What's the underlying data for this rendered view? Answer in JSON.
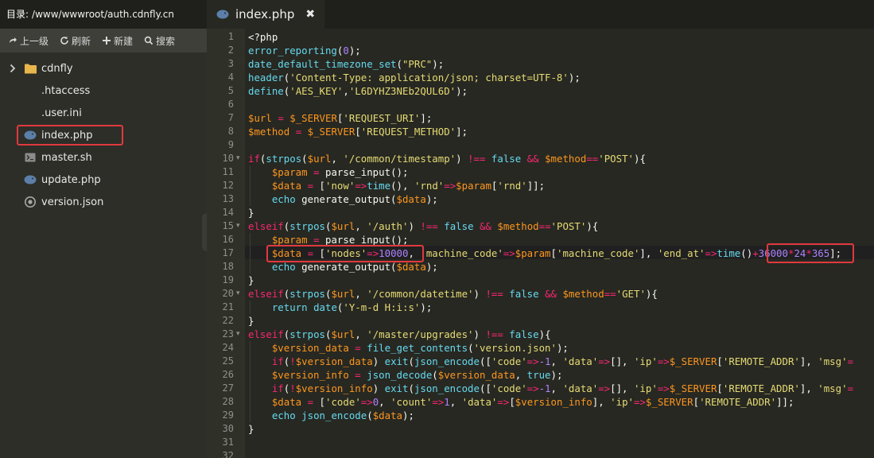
{
  "sidebar": {
    "path_label": "目录:",
    "path": "/www/wwwroot/auth.cdnfly.cn",
    "toolbar": [
      {
        "icon": "up-arrow-icon",
        "label": "上一级"
      },
      {
        "icon": "refresh-icon",
        "label": "刷新"
      },
      {
        "icon": "plus-icon",
        "label": "新建"
      },
      {
        "icon": "search-icon",
        "label": "搜索"
      }
    ],
    "items": [
      {
        "name": "cdnfly",
        "type": "folder"
      },
      {
        "name": ".htaccess",
        "type": "file"
      },
      {
        "name": ".user.ini",
        "type": "file"
      },
      {
        "name": "index.php",
        "type": "php",
        "selected": true
      },
      {
        "name": "master.sh",
        "type": "shell"
      },
      {
        "name": "update.php",
        "type": "php"
      },
      {
        "name": "version.json",
        "type": "json"
      }
    ]
  },
  "tab": {
    "name": "index.php",
    "close": "✖"
  },
  "colors": {
    "accent_red": "#e0393e",
    "editor_bg": "#272822"
  },
  "line_numbers": [
    "1",
    "2",
    "3",
    "4",
    "5",
    "6",
    "7",
    "8",
    "9",
    "10",
    "11",
    "12",
    "13",
    "14",
    "15",
    "16",
    "17",
    "18",
    "19",
    "20",
    "21",
    "22",
    "23",
    "24",
    "25",
    "26",
    "27",
    "28",
    "29",
    "30",
    "31",
    "32"
  ],
  "code_lines": [
    [
      [
        "t-pl",
        "<?php"
      ]
    ],
    [
      [
        "t-fn",
        "error_reporting"
      ],
      [
        "t-pl",
        "("
      ],
      [
        "t-num",
        "0"
      ],
      [
        "t-pl",
        ");"
      ]
    ],
    [
      [
        "t-fn",
        "date_default_timezone_set"
      ],
      [
        "t-pl",
        "("
      ],
      [
        "t-str",
        "\"PRC\""
      ],
      [
        "t-pl",
        ");"
      ]
    ],
    [
      [
        "t-fn",
        "header"
      ],
      [
        "t-pl",
        "("
      ],
      [
        "t-str",
        "'Content-Type: application/json; charset=UTF-8'"
      ],
      [
        "t-pl",
        ");"
      ]
    ],
    [
      [
        "t-fn",
        "define"
      ],
      [
        "t-pl",
        "("
      ],
      [
        "t-str",
        "'AES_KEY'"
      ],
      [
        "t-pl",
        ","
      ],
      [
        "t-str",
        "'L6DYHZ3NEb2QUL6D'"
      ],
      [
        "t-pl",
        ");"
      ]
    ],
    [],
    [
      [
        "t-var",
        "$url"
      ],
      [
        "t-pl",
        " "
      ],
      [
        "t-kw",
        "="
      ],
      [
        "t-pl",
        " "
      ],
      [
        "t-var",
        "$_SERVER"
      ],
      [
        "t-pl",
        "["
      ],
      [
        "t-str",
        "'REQUEST_URI'"
      ],
      [
        "t-pl",
        "];"
      ]
    ],
    [
      [
        "t-var",
        "$method"
      ],
      [
        "t-pl",
        " "
      ],
      [
        "t-kw",
        "="
      ],
      [
        "t-pl",
        " "
      ],
      [
        "t-var",
        "$_SERVER"
      ],
      [
        "t-pl",
        "["
      ],
      [
        "t-str",
        "'REQUEST_METHOD'"
      ],
      [
        "t-pl",
        "];"
      ]
    ],
    [],
    [
      [
        "t-kw",
        "if"
      ],
      [
        "t-pl",
        "("
      ],
      [
        "t-fn",
        "strpos"
      ],
      [
        "t-pl",
        "("
      ],
      [
        "t-var",
        "$url"
      ],
      [
        "t-pl",
        ", "
      ],
      [
        "t-str",
        "'/common/timestamp'"
      ],
      [
        "t-pl",
        ") "
      ],
      [
        "t-kw",
        "!=="
      ],
      [
        "t-pl",
        " "
      ],
      [
        "t-fn",
        "false"
      ],
      [
        "t-pl",
        " "
      ],
      [
        "t-kw",
        "&&"
      ],
      [
        "t-pl",
        " "
      ],
      [
        "t-var",
        "$method"
      ],
      [
        "t-kw",
        "=="
      ],
      [
        "t-str",
        "'POST'"
      ],
      [
        "t-pl",
        "){"
      ]
    ],
    [
      [
        "t-pl",
        "    "
      ],
      [
        "t-var",
        "$param"
      ],
      [
        "t-pl",
        " "
      ],
      [
        "t-kw",
        "="
      ],
      [
        "t-pl",
        " parse_input();"
      ]
    ],
    [
      [
        "t-pl",
        "    "
      ],
      [
        "t-var",
        "$data"
      ],
      [
        "t-pl",
        " "
      ],
      [
        "t-kw",
        "="
      ],
      [
        "t-pl",
        " ["
      ],
      [
        "t-str",
        "'now'"
      ],
      [
        "t-kw",
        "=>"
      ],
      [
        "t-fn",
        "time"
      ],
      [
        "t-pl",
        "(), "
      ],
      [
        "t-str",
        "'rnd'"
      ],
      [
        "t-kw",
        "=>"
      ],
      [
        "t-var",
        "$param"
      ],
      [
        "t-pl",
        "["
      ],
      [
        "t-str",
        "'rnd'"
      ],
      [
        "t-pl",
        "]];"
      ]
    ],
    [
      [
        "t-pl",
        "    "
      ],
      [
        "t-fn",
        "echo"
      ],
      [
        "t-pl",
        " generate_output("
      ],
      [
        "t-var",
        "$data"
      ],
      [
        "t-pl",
        ");"
      ]
    ],
    [
      [
        "t-pl",
        "}"
      ]
    ],
    [
      [
        "t-kw",
        "elseif"
      ],
      [
        "t-pl",
        "("
      ],
      [
        "t-fn",
        "strpos"
      ],
      [
        "t-pl",
        "("
      ],
      [
        "t-var",
        "$url"
      ],
      [
        "t-pl",
        ", "
      ],
      [
        "t-str",
        "'/auth'"
      ],
      [
        "t-pl",
        ") "
      ],
      [
        "t-kw",
        "!=="
      ],
      [
        "t-pl",
        " "
      ],
      [
        "t-fn",
        "false"
      ],
      [
        "t-pl",
        " "
      ],
      [
        "t-kw",
        "&&"
      ],
      [
        "t-pl",
        " "
      ],
      [
        "t-var",
        "$method"
      ],
      [
        "t-kw",
        "=="
      ],
      [
        "t-str",
        "'POST'"
      ],
      [
        "t-pl",
        "){"
      ]
    ],
    [
      [
        "t-pl",
        "    "
      ],
      [
        "t-var",
        "$param"
      ],
      [
        "t-pl",
        " "
      ],
      [
        "t-kw",
        "="
      ],
      [
        "t-pl",
        " parse_input();"
      ]
    ],
    [
      [
        "t-pl",
        "    "
      ],
      [
        "t-var",
        "$data"
      ],
      [
        "t-pl",
        " "
      ],
      [
        "t-kw",
        "="
      ],
      [
        "t-pl",
        " ["
      ],
      [
        "t-str",
        "'nodes'"
      ],
      [
        "t-kw",
        "=>"
      ],
      [
        "t-num",
        "10000"
      ],
      [
        "t-pl",
        ", "
      ],
      [
        "t-str",
        "'machine_code'"
      ],
      [
        "t-kw",
        "=>"
      ],
      [
        "t-var",
        "$param"
      ],
      [
        "t-pl",
        "["
      ],
      [
        "t-str",
        "'machine_code'"
      ],
      [
        "t-pl",
        "], "
      ],
      [
        "t-str",
        "'end_at'"
      ],
      [
        "t-kw",
        "=>"
      ],
      [
        "t-fn",
        "time"
      ],
      [
        "t-pl",
        "()"
      ],
      [
        "t-kw",
        "+"
      ],
      [
        "t-num",
        "36000"
      ],
      [
        "t-kw",
        "*"
      ],
      [
        "t-num",
        "24"
      ],
      [
        "t-kw",
        "*"
      ],
      [
        "t-num",
        "365"
      ],
      [
        "t-pl",
        "];"
      ]
    ],
    [
      [
        "t-pl",
        "    "
      ],
      [
        "t-fn",
        "echo"
      ],
      [
        "t-pl",
        " generate_output("
      ],
      [
        "t-var",
        "$data"
      ],
      [
        "t-pl",
        ");"
      ]
    ],
    [
      [
        "t-pl",
        "}"
      ]
    ],
    [
      [
        "t-kw",
        "elseif"
      ],
      [
        "t-pl",
        "("
      ],
      [
        "t-fn",
        "strpos"
      ],
      [
        "t-pl",
        "("
      ],
      [
        "t-var",
        "$url"
      ],
      [
        "t-pl",
        ", "
      ],
      [
        "t-str",
        "'/common/datetime'"
      ],
      [
        "t-pl",
        ") "
      ],
      [
        "t-kw",
        "!=="
      ],
      [
        "t-pl",
        " "
      ],
      [
        "t-fn",
        "false"
      ],
      [
        "t-pl",
        " "
      ],
      [
        "t-kw",
        "&&"
      ],
      [
        "t-pl",
        " "
      ],
      [
        "t-var",
        "$method"
      ],
      [
        "t-kw",
        "=="
      ],
      [
        "t-str",
        "'GET'"
      ],
      [
        "t-pl",
        "){"
      ]
    ],
    [
      [
        "t-pl",
        "    "
      ],
      [
        "t-fn",
        "return"
      ],
      [
        "t-pl",
        " "
      ],
      [
        "t-fn",
        "date"
      ],
      [
        "t-pl",
        "("
      ],
      [
        "t-str",
        "'Y-m-d H:i:s'"
      ],
      [
        "t-pl",
        ");"
      ]
    ],
    [
      [
        "t-pl",
        "}"
      ]
    ],
    [
      [
        "t-kw",
        "elseif"
      ],
      [
        "t-pl",
        "("
      ],
      [
        "t-fn",
        "strpos"
      ],
      [
        "t-pl",
        "("
      ],
      [
        "t-var",
        "$url"
      ],
      [
        "t-pl",
        ", "
      ],
      [
        "t-str",
        "'/master/upgrades'"
      ],
      [
        "t-pl",
        ") "
      ],
      [
        "t-kw",
        "!=="
      ],
      [
        "t-pl",
        " "
      ],
      [
        "t-fn",
        "false"
      ],
      [
        "t-pl",
        "){"
      ]
    ],
    [
      [
        "t-pl",
        "    "
      ],
      [
        "t-var",
        "$version_data"
      ],
      [
        "t-pl",
        " "
      ],
      [
        "t-kw",
        "="
      ],
      [
        "t-pl",
        " "
      ],
      [
        "t-fn",
        "file_get_contents"
      ],
      [
        "t-pl",
        "("
      ],
      [
        "t-str",
        "'version.json'"
      ],
      [
        "t-pl",
        ");"
      ]
    ],
    [
      [
        "t-pl",
        "    "
      ],
      [
        "t-kw",
        "if"
      ],
      [
        "t-pl",
        "("
      ],
      [
        "t-kw",
        "!"
      ],
      [
        "t-var",
        "$version_data"
      ],
      [
        "t-pl",
        ") "
      ],
      [
        "t-fn",
        "exit"
      ],
      [
        "t-pl",
        "("
      ],
      [
        "t-fn",
        "json_encode"
      ],
      [
        "t-pl",
        "(["
      ],
      [
        "t-str",
        "'code'"
      ],
      [
        "t-kw",
        "=>"
      ],
      [
        "t-num",
        "-1"
      ],
      [
        "t-pl",
        ", "
      ],
      [
        "t-str",
        "'data'"
      ],
      [
        "t-kw",
        "=>"
      ],
      [
        "t-pl",
        "[], "
      ],
      [
        "t-str",
        "'ip'"
      ],
      [
        "t-kw",
        "=>"
      ],
      [
        "t-var",
        "$_SERVER"
      ],
      [
        "t-pl",
        "["
      ],
      [
        "t-str",
        "'REMOTE_ADDR'"
      ],
      [
        "t-pl",
        "], "
      ],
      [
        "t-str",
        "'msg'"
      ],
      [
        "t-kw",
        "="
      ]
    ],
    [
      [
        "t-pl",
        "    "
      ],
      [
        "t-var",
        "$version_info"
      ],
      [
        "t-pl",
        " "
      ],
      [
        "t-kw",
        "="
      ],
      [
        "t-pl",
        " "
      ],
      [
        "t-fn",
        "json_decode"
      ],
      [
        "t-pl",
        "("
      ],
      [
        "t-var",
        "$version_data"
      ],
      [
        "t-pl",
        ", "
      ],
      [
        "t-fn",
        "true"
      ],
      [
        "t-pl",
        ");"
      ]
    ],
    [
      [
        "t-pl",
        "    "
      ],
      [
        "t-kw",
        "if"
      ],
      [
        "t-pl",
        "("
      ],
      [
        "t-kw",
        "!"
      ],
      [
        "t-var",
        "$version_info"
      ],
      [
        "t-pl",
        ") "
      ],
      [
        "t-fn",
        "exit"
      ],
      [
        "t-pl",
        "("
      ],
      [
        "t-fn",
        "json_encode"
      ],
      [
        "t-pl",
        "(["
      ],
      [
        "t-str",
        "'code'"
      ],
      [
        "t-kw",
        "=>"
      ],
      [
        "t-num",
        "-1"
      ],
      [
        "t-pl",
        ", "
      ],
      [
        "t-str",
        "'data'"
      ],
      [
        "t-kw",
        "=>"
      ],
      [
        "t-pl",
        "[], "
      ],
      [
        "t-str",
        "'ip'"
      ],
      [
        "t-kw",
        "=>"
      ],
      [
        "t-var",
        "$_SERVER"
      ],
      [
        "t-pl",
        "["
      ],
      [
        "t-str",
        "'REMOTE_ADDR'"
      ],
      [
        "t-pl",
        "], "
      ],
      [
        "t-str",
        "'msg'"
      ],
      [
        "t-kw",
        "="
      ]
    ],
    [
      [
        "t-pl",
        "    "
      ],
      [
        "t-var",
        "$data"
      ],
      [
        "t-pl",
        " "
      ],
      [
        "t-kw",
        "="
      ],
      [
        "t-pl",
        " ["
      ],
      [
        "t-str",
        "'code'"
      ],
      [
        "t-kw",
        "=>"
      ],
      [
        "t-num",
        "0"
      ],
      [
        "t-pl",
        ", "
      ],
      [
        "t-str",
        "'count'"
      ],
      [
        "t-kw",
        "=>"
      ],
      [
        "t-num",
        "1"
      ],
      [
        "t-pl",
        ", "
      ],
      [
        "t-str",
        "'data'"
      ],
      [
        "t-kw",
        "=>"
      ],
      [
        "t-pl",
        "["
      ],
      [
        "t-var",
        "$version_info"
      ],
      [
        "t-pl",
        "], "
      ],
      [
        "t-str",
        "'ip'"
      ],
      [
        "t-kw",
        "=>"
      ],
      [
        "t-var",
        "$_SERVER"
      ],
      [
        "t-pl",
        "["
      ],
      [
        "t-str",
        "'REMOTE_ADDR'"
      ],
      [
        "t-pl",
        "]];"
      ]
    ],
    [
      [
        "t-pl",
        "    "
      ],
      [
        "t-fn",
        "echo"
      ],
      [
        "t-pl",
        " "
      ],
      [
        "t-fn",
        "json_encode"
      ],
      [
        "t-pl",
        "("
      ],
      [
        "t-var",
        "$data"
      ],
      [
        "t-pl",
        ");"
      ]
    ],
    [
      [
        "t-pl",
        "}"
      ]
    ],
    [],
    []
  ]
}
